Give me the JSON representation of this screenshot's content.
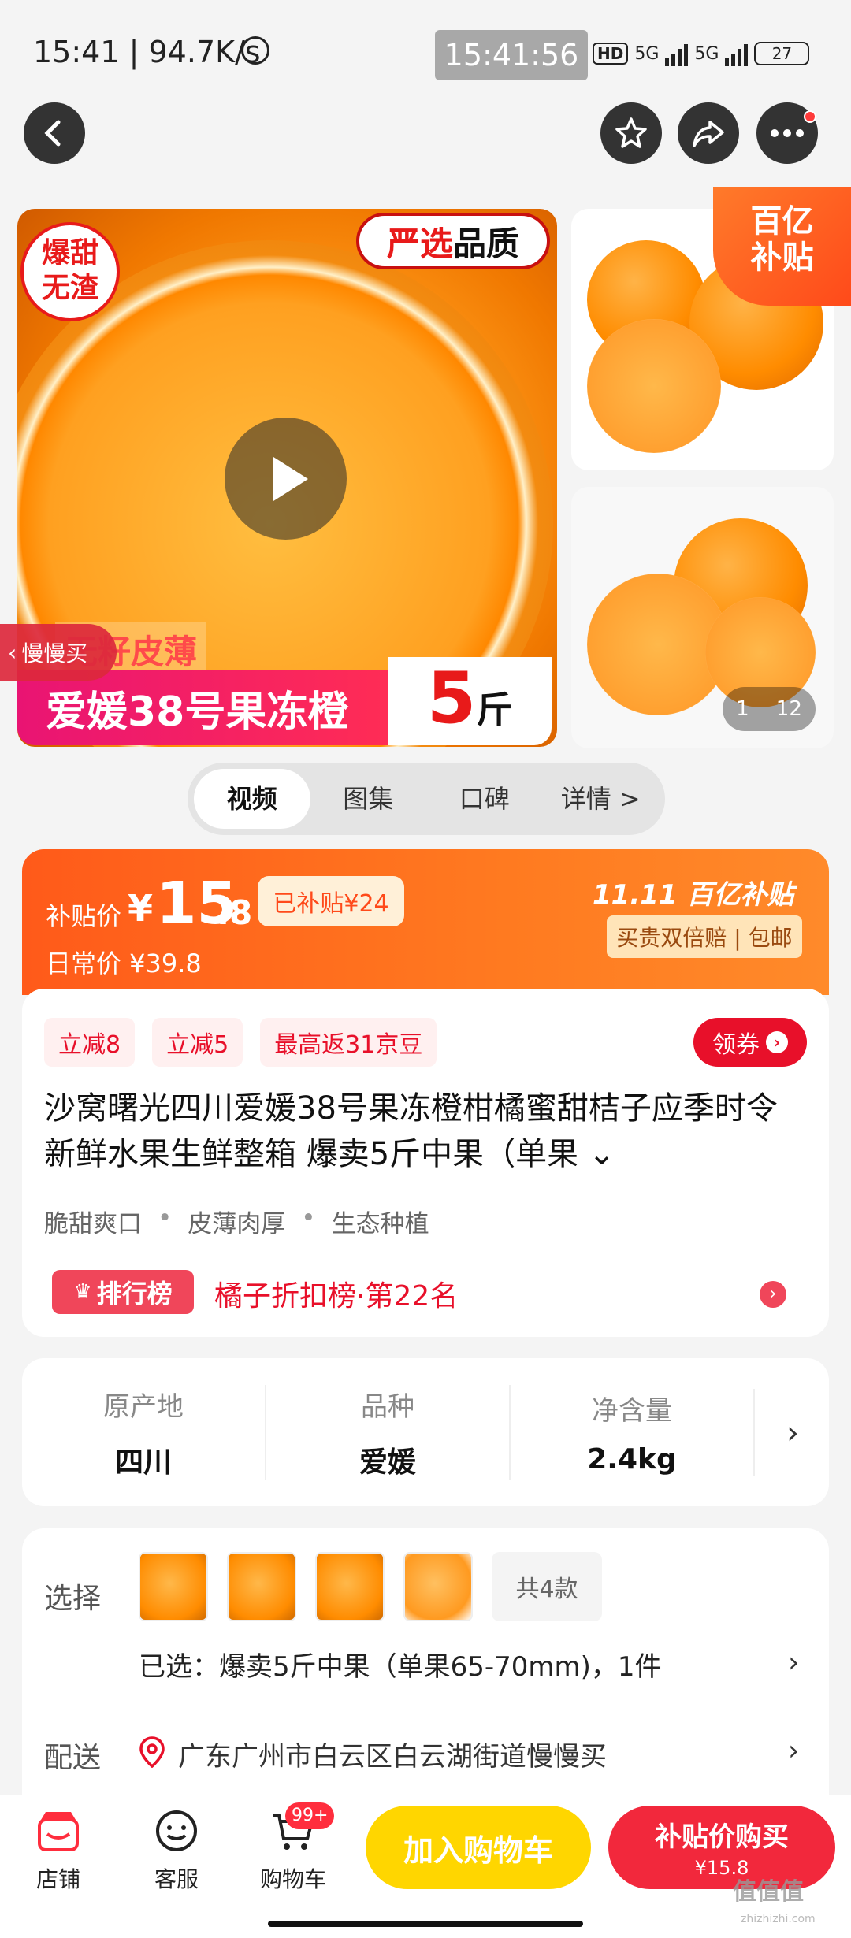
{
  "status_bar": {
    "time_speed": "15:41 | 94.7K/s",
    "clock": "15:41:56",
    "hd": "HD",
    "net1": "5G",
    "net2": "5G",
    "battery": "27"
  },
  "gallery": {
    "badge_sweet_1": "爆甜",
    "badge_sweet_2": "无渣",
    "badge_quality_a": "严选",
    "badge_quality_b": "品质",
    "thin_skin": "无籽皮薄",
    "banner_title": "爱媛38号果冻橙",
    "banner_num": "5",
    "banner_unit": "斤",
    "slow_buy": "慢慢买",
    "subsidy_1": "百亿",
    "subsidy_2": "补贴",
    "counter_current": "1",
    "counter_total": "12"
  },
  "tabs": [
    "视频",
    "图集",
    "口碑",
    "详情 >"
  ],
  "price": {
    "label": "补贴价",
    "yen": "¥",
    "int": "15",
    "dec": ".8",
    "already": "已补贴¥24",
    "daily": "日常价 ¥39.8",
    "event_logo": "11.11 百亿补贴",
    "event_tags": "买贵双倍赔 | 包邮"
  },
  "info": {
    "chips": [
      "立减8",
      "立减5",
      "最高返31京豆"
    ],
    "coupon": "领券",
    "title": "沙窝曙光四川爱媛38号果冻橙柑橘蜜甜桔子应季时令新鲜水果生鲜整箱 爆卖5斤中果（单果 ⌄",
    "features": [
      "脆甜爽口",
      "皮薄肉厚",
      "生态种植"
    ],
    "rank_badge": "排行榜",
    "rank_text": "橘子折扣榜·第22名"
  },
  "specs": [
    {
      "k": "原产地",
      "v": "四川"
    },
    {
      "k": "品种",
      "v": "爱媛"
    },
    {
      "k": "净含量",
      "v": "2.4kg"
    }
  ],
  "select": {
    "label": "选择",
    "count": "共4款",
    "selected": "已选：爆卖5斤中果（单果65-70mm)，1件",
    "ship_label": "配送",
    "ship_addr": "广东广州市白云区白云湖街道慢慢买"
  },
  "bottom": {
    "shop": "店铺",
    "service": "客服",
    "cart": "购物车",
    "cart_badge": "99+",
    "add_cart": "加入购物车",
    "buy_title": "补贴价购买",
    "buy_price": "¥15.8",
    "watermark": "值值值",
    "watermark2": "zhizhizhi.com"
  },
  "colors": {
    "accent_red": "#f2283c",
    "accent_orange": "#ff5a1a",
    "cart_yellow": "#ffd600"
  }
}
